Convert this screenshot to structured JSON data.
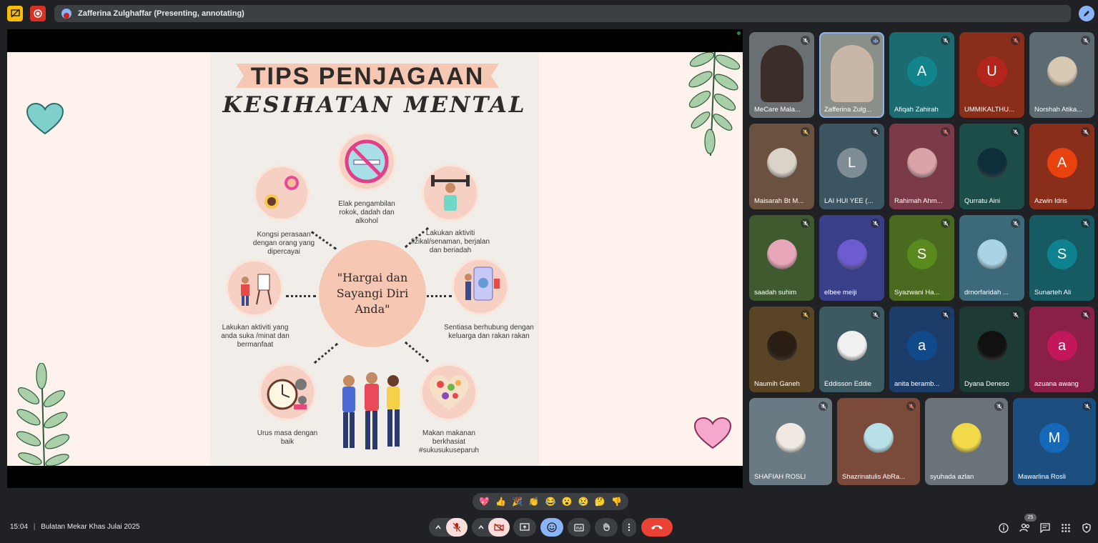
{
  "top": {
    "presenter_text": "Zafferina Zulghaffar (Presenting, annotating)"
  },
  "slide": {
    "title_line1": "TIPS PENJAGAAN",
    "title_line2": "KESIHATAN MENTAL",
    "center_text": "\"Hargai dan Sayangi Diri Anda\"",
    "tips": [
      "Elak pengambilan rokok, dadah dan alkohol",
      "Kongsi perasaan dengan orang yang dipercayai",
      "Lakukan aktiviti fizikal/senaman, berjalan dan beriadah",
      "Lakukan aktiviti yang anda suka /minat dan bermanfaat",
      "Sentiasa berhubung dengan keluarga dan rakan rakan",
      "Urus masa dengan baik",
      "Makan makanan berkhasiat #sukusukuseparuh"
    ]
  },
  "participants": [
    {
      "name": "MeCare Mala...",
      "type": "photo",
      "bg": "#6a6f73",
      "color": "#3a2e2a",
      "status": "muted"
    },
    {
      "name": "Zafferina Zulg...",
      "type": "photo",
      "bg": "#8b8f8a",
      "color": "#c8b6a6",
      "status": "speaking"
    },
    {
      "name": "Afiqah Zahirah",
      "type": "letter",
      "letter": "A",
      "bg": "#1b6b70",
      "color": "#12858c",
      "status": "muted"
    },
    {
      "name": "UMMIKALTHU...",
      "type": "letter",
      "letter": "U",
      "bg": "#8a2e1c",
      "color": "#b3261e",
      "status": "muted-red"
    },
    {
      "name": "Norshah Atika...",
      "type": "photo",
      "bg": "#5d6a72",
      "color": "#d8c9b5",
      "status": "muted"
    },
    {
      "name": "Maisarah Bt M...",
      "type": "photo",
      "bg": "#6b5240",
      "color": "#dcd3c8",
      "status": "muted-gold"
    },
    {
      "name": "LAI HUI YEE (...",
      "type": "letter",
      "letter": "L",
      "bg": "#3c5563",
      "color": "#7d8c95",
      "status": "muted"
    },
    {
      "name": "Rahimah Ahm...",
      "type": "photo",
      "bg": "#7a3a48",
      "color": "#d9a3a8",
      "status": "muted-red"
    },
    {
      "name": "Qurratu Aini",
      "type": "photo",
      "bg": "#1d4d48",
      "color": "#0f2e3c",
      "status": "muted"
    },
    {
      "name": "Azwin Idris",
      "type": "letter",
      "letter": "A",
      "bg": "#8a2e1c",
      "color": "#e8430f",
      "status": "muted"
    },
    {
      "name": "saadah suhim",
      "type": "photo",
      "bg": "#3e5a2e",
      "color": "#e8a7b8",
      "status": "muted"
    },
    {
      "name": "elbee meiji",
      "type": "photo",
      "bg": "#3a3f8a",
      "color": "#6d5bd0",
      "status": "muted"
    },
    {
      "name": "Syazwani Ha...",
      "type": "letter",
      "letter": "S",
      "bg": "#4a6a20",
      "color": "#5a8a1e",
      "status": "muted"
    },
    {
      "name": "drnorfaridah ...",
      "type": "photo",
      "bg": "#3d6a7a",
      "color": "#a8d4e6",
      "status": "muted"
    },
    {
      "name": "Sunarteh Ali",
      "type": "letter",
      "letter": "S",
      "bg": "#165a62",
      "color": "#0f8290",
      "status": "muted"
    },
    {
      "name": "Naumih Ganeh",
      "type": "photo",
      "bg": "#5a4426",
      "color": "#2a1e14",
      "status": "muted-gold"
    },
    {
      "name": "Eddisson Eddie",
      "type": "photo",
      "bg": "#3d5a62",
      "color": "#f0f0f0",
      "status": "muted"
    },
    {
      "name": "anita beramb...",
      "type": "letter",
      "letter": "a",
      "bg": "#1c3d6a",
      "color": "#114a8a",
      "status": "muted"
    },
    {
      "name": "Dyana Deneso",
      "type": "photo",
      "bg": "#1e3a34",
      "color": "#111111",
      "status": "muted"
    },
    {
      "name": "azuana awang",
      "type": "letter",
      "letter": "a",
      "bg": "#8a2048",
      "color": "#c2185b",
      "status": "muted"
    },
    {
      "name": "SHAFIAH ROSLI",
      "type": "photo",
      "bg": "#6a7a82",
      "color": "#efe9e2",
      "status": "muted"
    },
    {
      "name": "Shazrinatulis AbRa...",
      "type": "photo",
      "bg": "#7a4a3a",
      "color": "#b8e0e8",
      "status": "muted-red"
    },
    {
      "name": "syuhada azlan",
      "type": "photo",
      "bg": "#6a727a",
      "color": "#f1d94a",
      "status": "muted"
    },
    {
      "name": "Mawarlina Rosli",
      "type": "letter",
      "letter": "M",
      "bg": "#1c4f80",
      "color": "#1669b8",
      "status": "muted"
    }
  ],
  "reactions": [
    "💖",
    "👍",
    "🎉",
    "👏",
    "😂",
    "😮",
    "😢",
    "🤔",
    "👎"
  ],
  "bottom": {
    "time": "15:04",
    "separator": "|",
    "meeting_title": "Bulatan Mekar Khas Julai 2025",
    "people_count": "25"
  },
  "colors": {
    "end_call": "#ea4335",
    "muted_ctrl": "#f9dedc",
    "accent": "#8ab4f8"
  }
}
